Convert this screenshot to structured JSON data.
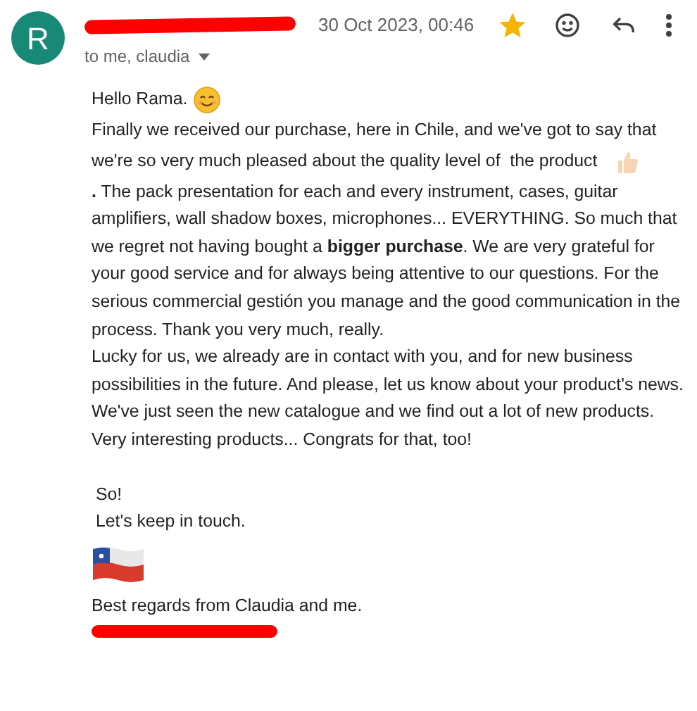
{
  "sender": {
    "avatar_letter": "R",
    "date": "30 Oct 2023, 00:46",
    "starred": true,
    "recipients": "to me, claudia"
  },
  "body": [
    {
      "kind": "greeting",
      "text": "Hello Rama."
    },
    {
      "kind": "thumb",
      "lines": [
        "Finally we received our purchase, here in Chile, and we've got to say that",
        "we're so very much pleased about the quality level of  the product"
      ]
    },
    {
      "kind": "plain",
      "text": "**.** The pack presentation for each and every instrument, cases, guitar amplifiers, wall shadow boxes, microphones... EVERYTHING. So much that we regret not having bought a **bigger purchase**. We are very grateful for your good service and for always being attentive to our questions. For the serious commercial gestión you manage and the good communication in the process. Thank you very much, really."
    },
    {
      "kind": "plain",
      "text": "Lucky for us, we already are in contact with you, and for new business possibilities in the future. And please, let us know about your product's news."
    },
    {
      "kind": "plain",
      "text": "We've just seen the new catalogue and we find out a lot of new products. Very interesting products... Congrats for that, too!"
    }
  ],
  "closing": [
    {
      "kind": "gap"
    },
    {
      "kind": "indented",
      "text": "So!"
    },
    {
      "kind": "indented",
      "text": "Let's keep in touch."
    },
    {
      "kind": "flag"
    },
    {
      "kind": "plain",
      "text": "Best regards from Claudia and me."
    },
    {
      "kind": "redacted"
    }
  ]
}
